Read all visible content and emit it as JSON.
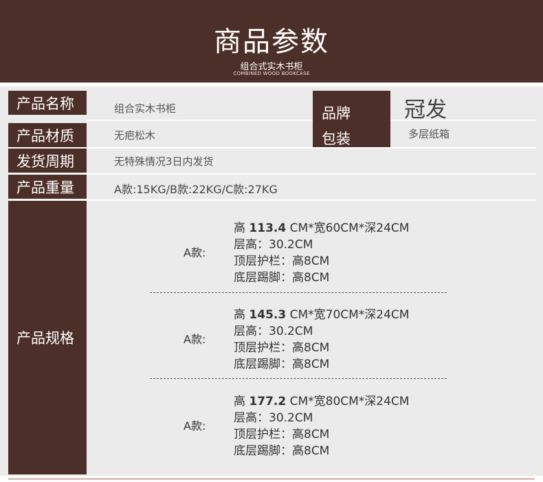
{
  "header": {
    "title": "商品参数",
    "subtitle": "组合式实木书柜",
    "subtitle_en": "COMBINED WOOD BOOKCASE"
  },
  "rows": {
    "name": {
      "label": "产品名称",
      "value": "组合实木书柜"
    },
    "material": {
      "label": "产品材质",
      "value": "无疤松木"
    },
    "delivery": {
      "label": "发货周期",
      "value": "无特殊情况3日内发货"
    },
    "weight": {
      "label": "产品重量",
      "value": "A款:15KG/B款:22KG/C款:27KG"
    },
    "brand": {
      "label": "品牌",
      "value": "冠发"
    },
    "package": {
      "label": "包装",
      "value": "多层纸箱"
    },
    "spec": {
      "label": "产品规格"
    }
  },
  "specs": [
    {
      "model": "A款:",
      "height_prefix": "高 ",
      "height": "113.4",
      "size_rest": " CM*宽60CM*深24CM",
      "layer": "层高：30.2CM",
      "top_rail": "顶层护栏：高8CM",
      "kick": "底层踢脚：高8CM"
    },
    {
      "model": "A款:",
      "height_prefix": "高 ",
      "height": "145.3",
      "size_rest": " CM*宽70CM*深24CM",
      "layer": "层高：30.2CM",
      "top_rail": "顶层护栏：高8CM",
      "kick": "底层踢脚：高8CM"
    },
    {
      "model": "A款:",
      "height_prefix": "高 ",
      "height": "177.2",
      "size_rest": " CM*宽80CM*深24CM",
      "layer": "层高：30.2CM",
      "top_rail": "顶层护栏：高8CM",
      "kick": "底层踢脚：高8CM"
    }
  ],
  "colors": {
    "brand_brown": "#4d2f29",
    "panel_gray": "#ebebeb"
  }
}
